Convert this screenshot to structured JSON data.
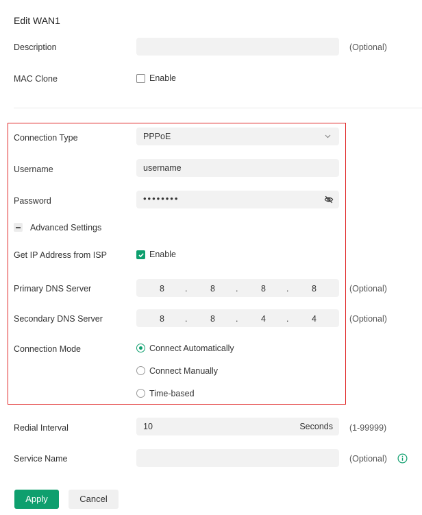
{
  "title": "Edit WAN1",
  "description": {
    "label": "Description",
    "value": "",
    "hint": "(Optional)"
  },
  "mac_clone": {
    "label": "MAC Clone",
    "option": "Enable",
    "checked": false
  },
  "connection_type": {
    "label": "Connection Type",
    "value": "PPPoE"
  },
  "username": {
    "label": "Username",
    "value": "username"
  },
  "password": {
    "label": "Password",
    "masked": "••••••••"
  },
  "advanced": {
    "label": "Advanced Settings",
    "expanded": true
  },
  "get_ip": {
    "label": "Get IP Address from ISP",
    "option": "Enable",
    "checked": true
  },
  "primary_dns": {
    "label": "Primary DNS Server",
    "octets": [
      "8",
      "8",
      "8",
      "8"
    ],
    "hint": "(Optional)"
  },
  "secondary_dns": {
    "label": "Secondary DNS Server",
    "octets": [
      "8",
      "8",
      "4",
      "4"
    ],
    "hint": "(Optional)"
  },
  "connection_mode": {
    "label": "Connection Mode",
    "options": [
      "Connect Automatically",
      "Connect Manually",
      "Time-based"
    ],
    "selected": "Connect Automatically"
  },
  "redial": {
    "label": "Redial Interval",
    "value": "10",
    "unit": "Seconds",
    "hint": "(1-99999)"
  },
  "service_name": {
    "label": "Service Name",
    "value": "",
    "hint": "(Optional)"
  },
  "buttons": {
    "apply": "Apply",
    "cancel": "Cancel"
  },
  "colors": {
    "accent": "#0e9f6e",
    "highlight_border": "#e02424"
  }
}
